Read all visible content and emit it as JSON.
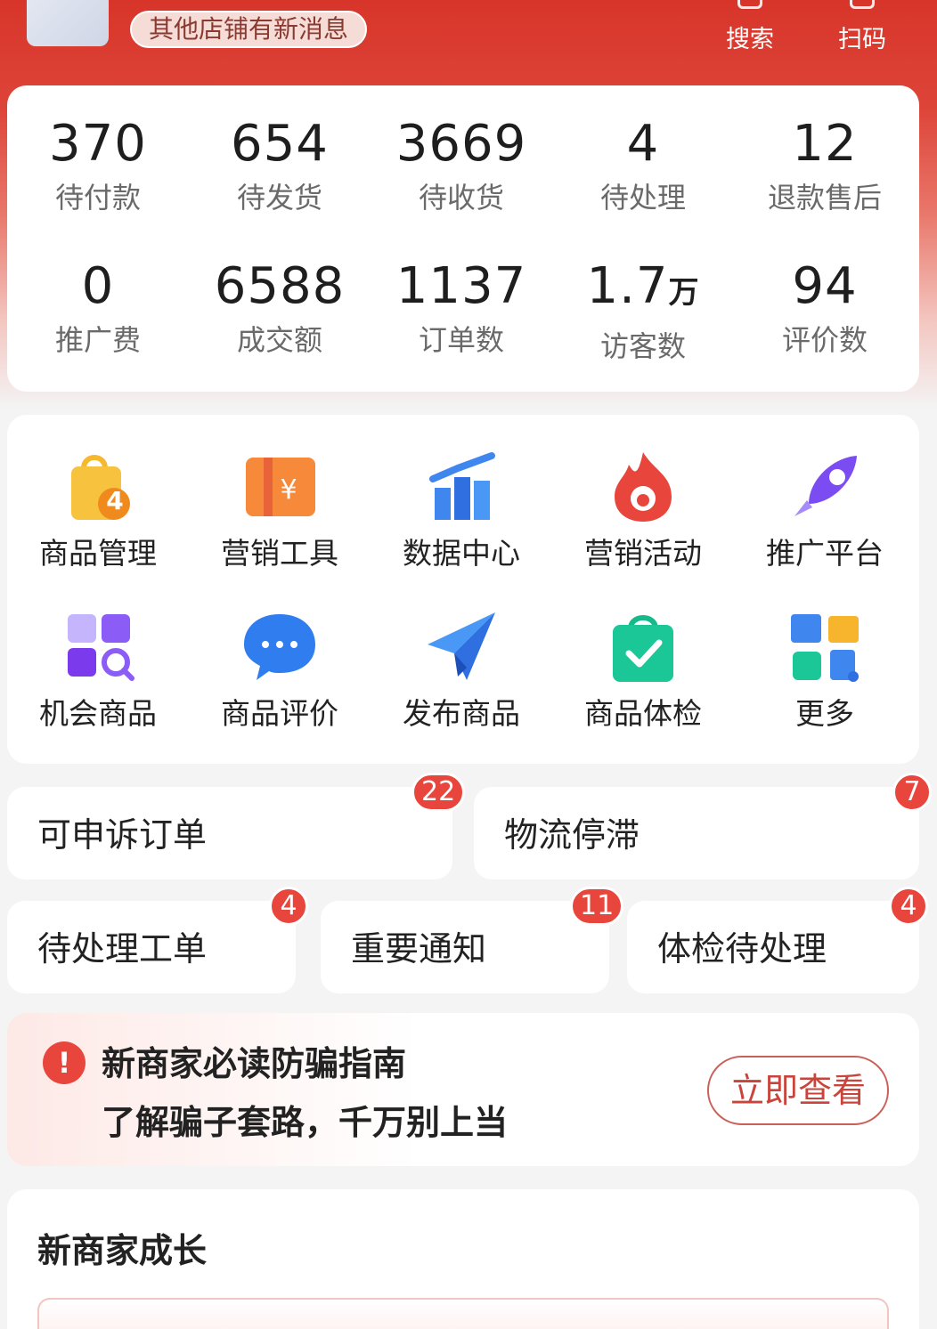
{
  "header": {
    "notice": "其他店铺有新消息",
    "actions": [
      {
        "label": "搜索",
        "icon": "search-icon"
      },
      {
        "label": "扫码",
        "icon": "scan-icon"
      }
    ]
  },
  "stats": {
    "row1": [
      {
        "value": "370",
        "label": "待付款"
      },
      {
        "value": "654",
        "label": "待发货"
      },
      {
        "value": "3669",
        "label": "待收货"
      },
      {
        "value": "4",
        "label": "待处理"
      },
      {
        "value": "12",
        "label": "退款售后"
      }
    ],
    "row2": [
      {
        "value": "0",
        "label": "推广费"
      },
      {
        "value": "6588",
        "label": "成交额"
      },
      {
        "value": "1137",
        "label": "订单数"
      },
      {
        "value": "1.7",
        "unit": "万",
        "label": "访客数"
      },
      {
        "value": "94",
        "label": "评价数"
      }
    ]
  },
  "tools": {
    "row1": [
      {
        "label": "商品管理",
        "icon": "shopping-bag-icon",
        "badge": "4"
      },
      {
        "label": "营销工具",
        "icon": "coupon-icon"
      },
      {
        "label": "数据中心",
        "icon": "bar-chart-icon"
      },
      {
        "label": "营销活动",
        "icon": "flame-icon"
      },
      {
        "label": "推广平台",
        "icon": "rocket-icon"
      }
    ],
    "row2": [
      {
        "label": "机会商品",
        "icon": "grid-search-icon"
      },
      {
        "label": "商品评价",
        "icon": "chat-bubble-icon"
      },
      {
        "label": "发布商品",
        "icon": "paper-plane-icon"
      },
      {
        "label": "商品体检",
        "icon": "checked-bag-icon"
      },
      {
        "label": "更多",
        "icon": "more-apps-icon"
      }
    ]
  },
  "tasks": {
    "row1": [
      {
        "label": "可申诉订单",
        "badge": "22"
      },
      {
        "label": "物流停滞",
        "badge": "7"
      }
    ],
    "row2": [
      {
        "label": "待处理工单",
        "badge": "4"
      },
      {
        "label": "重要通知",
        "badge": "11"
      },
      {
        "label": "体检待处理",
        "badge": "4"
      }
    ]
  },
  "guide": {
    "title": "新商家必读防骗指南",
    "subtitle": "了解骗子套路，千万别上当",
    "button": "立即查看",
    "alert_glyph": "!"
  },
  "growth": {
    "title": "新商家成长"
  },
  "colors": {
    "brand_red": "#d8352a",
    "badge_red": "#e8453c"
  }
}
